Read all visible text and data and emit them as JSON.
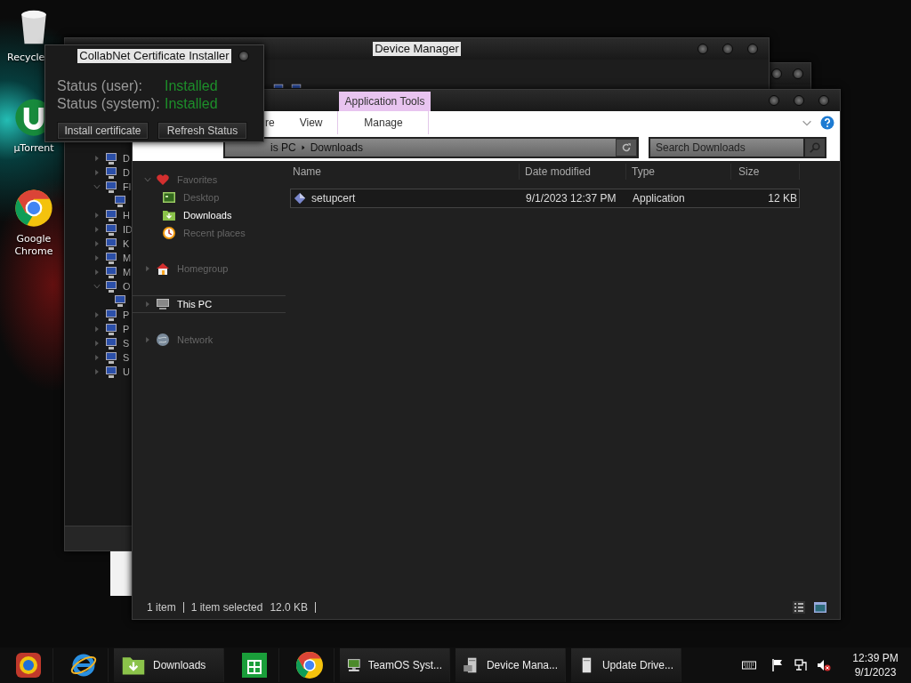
{
  "desktop_icons": [
    {
      "label": "Recycle",
      "kind": "bin"
    },
    {
      "label": "µTorrent",
      "kind": "torrent"
    },
    {
      "label": "Google Chrome",
      "kind": "chrome"
    }
  ],
  "device_manager": {
    "title": "Device Manager",
    "tree": [
      {
        "label": "D",
        "expanded": false
      },
      {
        "label": "D",
        "expanded": false
      },
      {
        "label": "Fl",
        "expanded": true,
        "children": [
          {
            "kind": "device"
          }
        ]
      },
      {
        "label": "H",
        "expanded": false
      },
      {
        "label": "ID",
        "expanded": false
      },
      {
        "label": "K",
        "expanded": false
      },
      {
        "label": "M",
        "expanded": false
      },
      {
        "label": "M",
        "expanded": false
      },
      {
        "label": "O",
        "expanded": true,
        "children": [
          {
            "kind": "device"
          }
        ]
      },
      {
        "label": "P",
        "expanded": false
      },
      {
        "label": "P",
        "expanded": false
      },
      {
        "label": "S",
        "expanded": false
      },
      {
        "label": "S",
        "expanded": false
      },
      {
        "label": "U",
        "expanded": false
      }
    ]
  },
  "explorer": {
    "context_tab": "Application Tools",
    "ribbon_tabs": [
      {
        "label": "re",
        "selected": false
      },
      {
        "label": "View",
        "selected": false
      },
      {
        "label": "Manage",
        "selected": false
      }
    ],
    "breadcrumb": [
      "is PC",
      "Downloads"
    ],
    "search": {
      "placeholder": "Search Downloads"
    },
    "nav": [
      {
        "label": "Favorites",
        "kind": "favorites",
        "expanded": true,
        "hovered": false,
        "children": [
          {
            "label": "Desktop",
            "kind": "desktop",
            "selected": false
          },
          {
            "label": "Downloads",
            "kind": "downloads",
            "selected": true
          },
          {
            "label": "Recent places",
            "kind": "recent",
            "selected": false
          }
        ]
      },
      {
        "label": "Homegroup",
        "kind": "homegroup",
        "expanded": false,
        "hovered": false
      },
      {
        "label": "This PC",
        "kind": "pc",
        "expanded": false,
        "hovered": true
      },
      {
        "label": "Network",
        "kind": "network",
        "expanded": false,
        "hovered": false
      }
    ],
    "columns": [
      "Name",
      "Date modified",
      "Type",
      "Size"
    ],
    "rows": [
      {
        "name": "setupcert",
        "kind": "app",
        "date_modified": "9/1/2023 12:37 PM",
        "type": "Application",
        "size": "12 KB",
        "selected": true
      }
    ],
    "status_bar": {
      "item_count": "1 item",
      "selection": "1 item selected",
      "size": "12.0 KB"
    }
  },
  "dialog": {
    "title": "CollabNet Certificate Installer",
    "statuses": [
      {
        "label": "Status (user):",
        "value": "Installed"
      },
      {
        "label": "Status (system):",
        "value": "Installed"
      }
    ],
    "buttons": [
      "Install certificate",
      "Refresh Status"
    ]
  },
  "taskbar": {
    "items": [
      {
        "kind": "media"
      },
      {
        "kind": "ie"
      },
      {
        "kind": "folder",
        "label": "Downloads"
      },
      {
        "kind": "store"
      },
      {
        "kind": "chrome"
      },
      {
        "kind": "monitor",
        "label": "TeamOS Syst..."
      },
      {
        "kind": "devmgr",
        "label": "Device Mana..."
      },
      {
        "kind": "tower",
        "label": "Update Drive..."
      }
    ],
    "tray": [
      {
        "kind": "keyboard"
      },
      {
        "kind": "flag"
      },
      {
        "kind": "net"
      },
      {
        "kind": "muted"
      }
    ],
    "clock": {
      "time": "12:39 PM",
      "date": "9/1/2023"
    }
  }
}
